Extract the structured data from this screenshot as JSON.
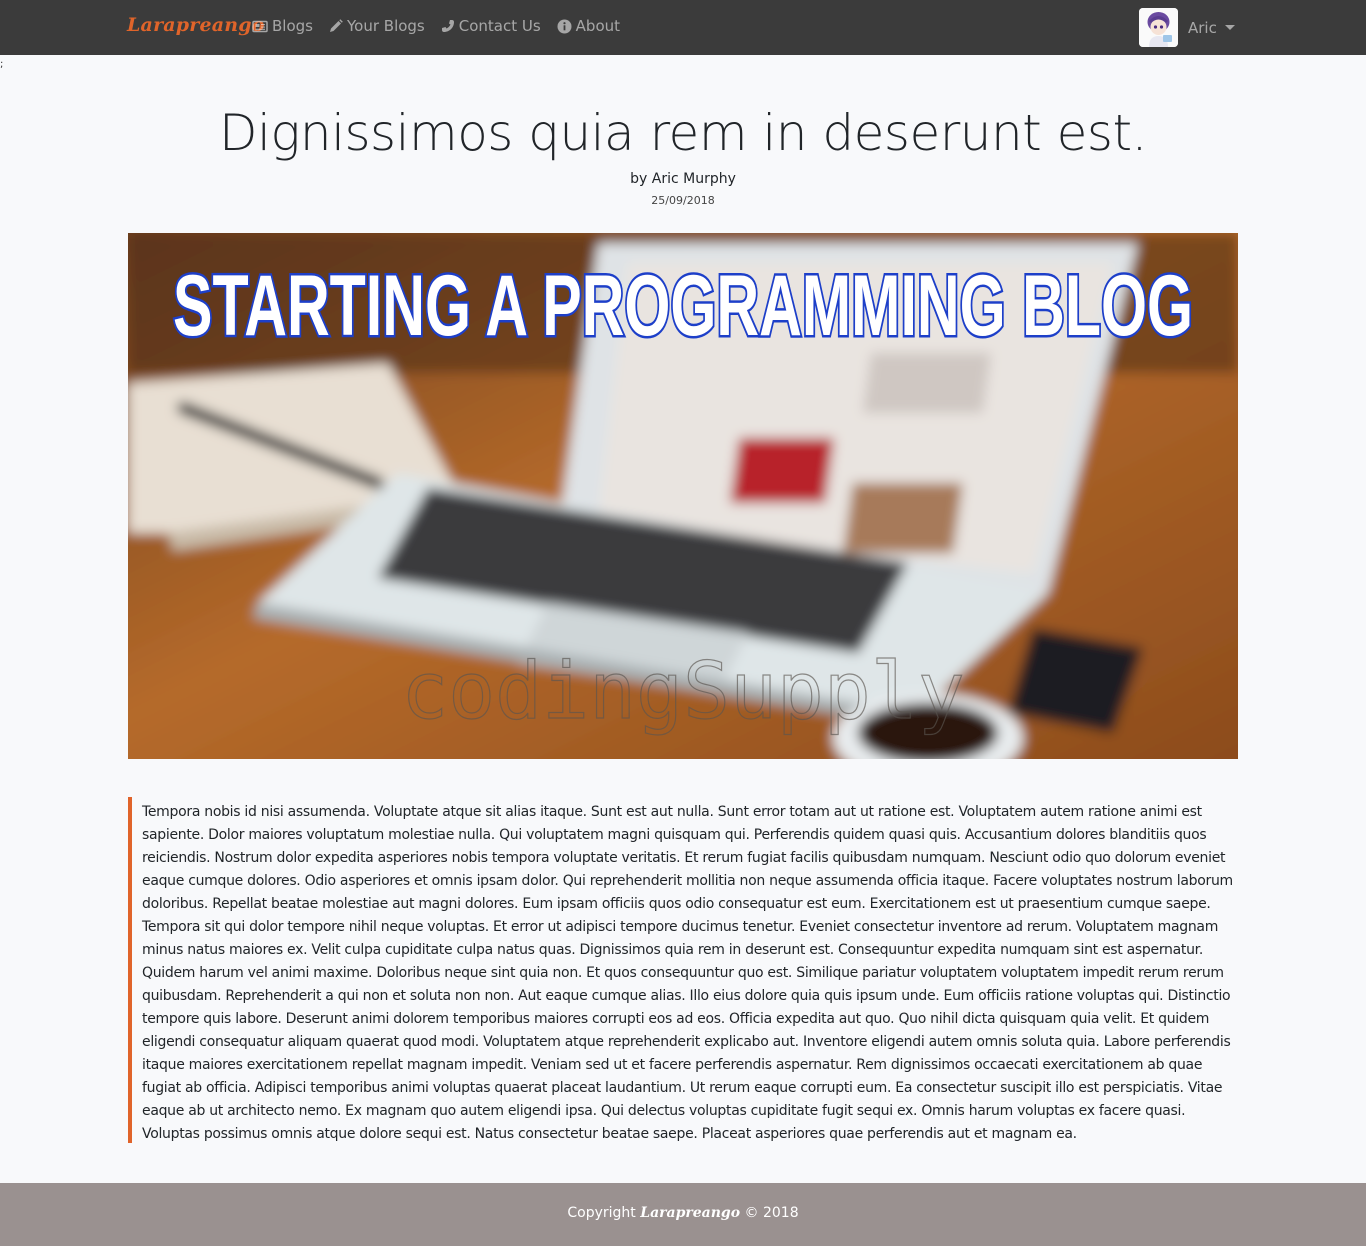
{
  "navbar": {
    "brand": "Larapreango",
    "links": [
      {
        "label": "Blogs",
        "icon": "newspaper-icon"
      },
      {
        "label": "Your Blogs",
        "icon": "pencil-icon"
      },
      {
        "label": "Contact Us",
        "icon": "phone-icon"
      },
      {
        "label": "About",
        "icon": "info-circle-icon"
      }
    ],
    "user": {
      "name": "Aric"
    }
  },
  "stray_text": ";",
  "post": {
    "title": "Dignissimos quia rem in deserunt est.",
    "author": "by Aric Murphy",
    "date": "25/09/2018",
    "image_title": "STARTING A PROGRAMMING BLOG",
    "image_watermark": "codingSupply",
    "body": "Tempora nobis id nisi assumenda. Voluptate atque sit alias itaque. Sunt est aut nulla. Sunt error totam aut ut ratione est. Voluptatem autem ratione animi est sapiente. Dolor maiores voluptatum molestiae nulla. Qui voluptatem magni quisquam qui. Perferendis quidem quasi quis. Accusantium dolores blanditiis quos reiciendis. Nostrum dolor expedita asperiores nobis tempora voluptate veritatis. Et rerum fugiat facilis quibusdam numquam. Nesciunt odio quo dolorum eveniet eaque cumque dolores. Odio asperiores et omnis ipsam dolor. Qui reprehenderit mollitia non neque assumenda officia itaque. Facere voluptates nostrum laborum doloribus. Repellat beatae molestiae aut magni dolores. Eum ipsam officiis quos odio consequatur est eum. Exercitationem est ut praesentium cumque saepe. Tempora sit qui dolor tempore nihil neque voluptas. Et error ut adipisci tempore ducimus tenetur. Eveniet consectetur inventore ad rerum. Voluptatem magnam minus natus maiores ex. Velit culpa cupiditate culpa natus quas. Dignissimos quia rem in deserunt est. Consequuntur expedita numquam sint est aspernatur. Quidem harum vel animi maxime. Doloribus neque sint quia non. Et quos consequuntur quo est. Similique pariatur voluptatem voluptatem impedit rerum rerum quibusdam. Reprehenderit a qui non et soluta non non. Aut eaque cumque alias. Illo eius dolore quia quis ipsum unde. Eum officiis ratione voluptas qui. Distinctio tempore quis labore. Deserunt animi dolorem temporibus maiores corrupti eos ad eos. Officia expedita aut quo. Quo nihil dicta quisquam quia velit. Et quidem eligendi consequatur aliquam quaerat quod modi. Voluptatem atque reprehenderit explicabo aut. Inventore eligendi autem omnis soluta quia. Labore perferendis itaque maiores exercitationem repellat magnam impedit. Veniam sed ut et facere perferendis aspernatur. Rem dignissimos occaecati exercitationem ab quae fugiat ab officia. Adipisci temporibus animi voluptas quaerat placeat laudantium. Ut rerum eaque corrupti eum. Ea consectetur suscipit illo est perspiciatis. Vitae eaque ab ut architecto nemo. Ex magnam quo autem eligendi ipsa. Qui delectus voluptas cupiditate fugit sequi ex. Omnis harum voluptas ex facere quasi. Voluptas possimus omnis atque dolore sequi est. Natus consectetur beatae saepe. Placeat asperiores quae perferendis aut et magnam ea."
  },
  "footer": {
    "prefix": "Copyright",
    "brand": "Larapreango",
    "suffix": "© 2018"
  },
  "colors": {
    "navbar_bg": "#3b3b3b",
    "brand": "#e0642a",
    "accent_border": "#e0642a",
    "footer_bg": "#9a9190",
    "page_bg": "#f8f9fb"
  }
}
